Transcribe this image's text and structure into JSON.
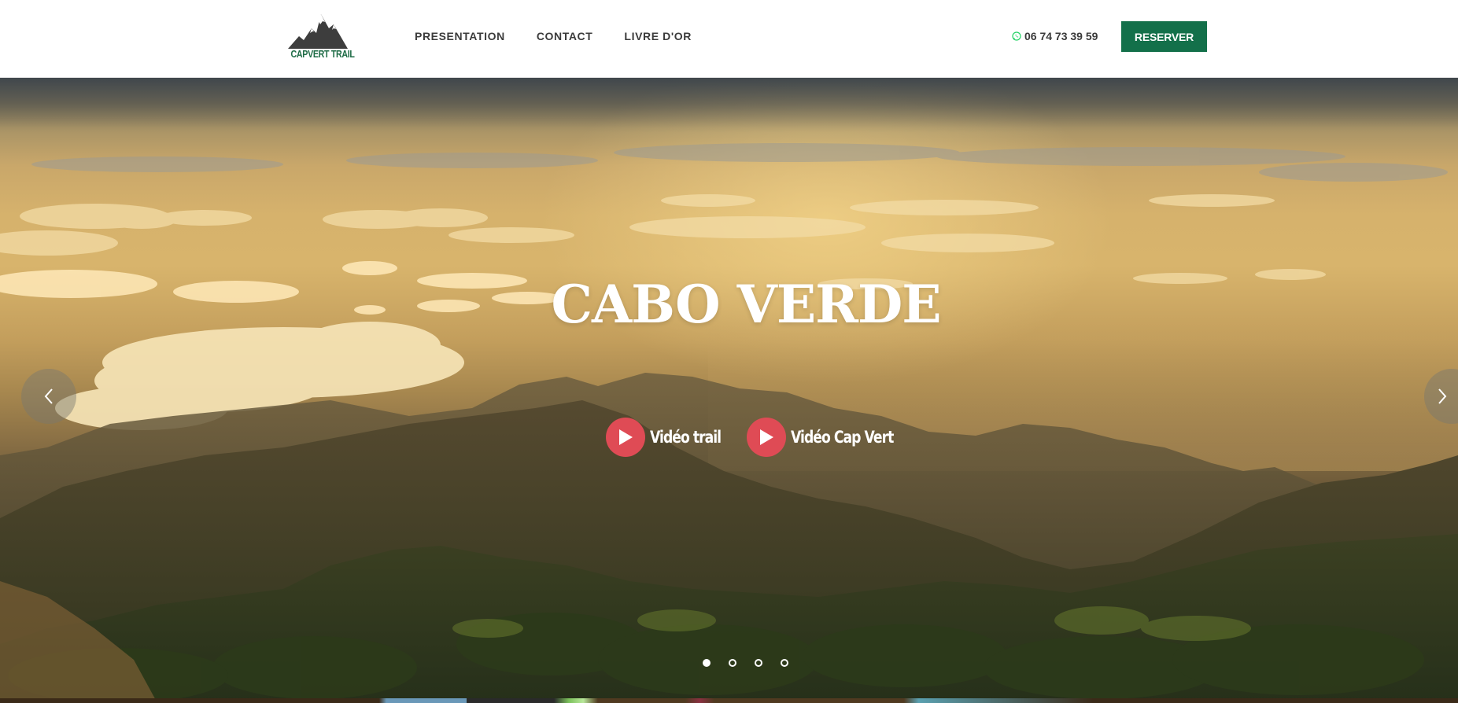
{
  "header": {
    "logo_text": "CAPVERT TRAIL",
    "nav": [
      {
        "label": "PRESENTATION"
      },
      {
        "label": "CONTACT"
      },
      {
        "label": "LIVRE D'OR"
      }
    ],
    "phone": "06 74 73 39 59",
    "phone_icon": "whatsapp-icon",
    "reserve_label": "RESERVER"
  },
  "hero": {
    "title": "CABO VERDE",
    "videos": [
      {
        "label": "Vidéo trail",
        "icon": "play-icon"
      },
      {
        "label": "Vidéo Cap Vert",
        "icon": "play-icon"
      }
    ],
    "prev_icon": "chevron-left-icon",
    "next_icon": "chevron-right-icon",
    "slides": {
      "count": 4,
      "active": 1
    }
  },
  "colors": {
    "brand_green": "#13704a",
    "logo_green": "#1d6b45",
    "play_red": "#df4b55",
    "nav_text": "#3b3b3b",
    "whatsapp_green": "#25d366"
  }
}
